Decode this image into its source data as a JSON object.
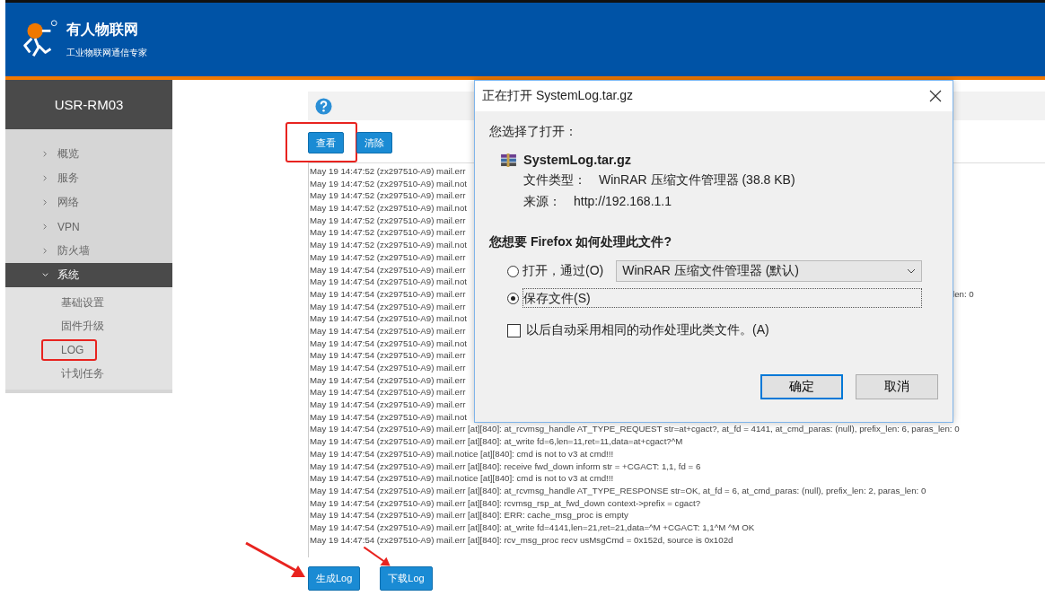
{
  "header": {
    "brand": "有人物联网",
    "slogan": "工业物联网通信专家"
  },
  "sidebar": {
    "device": "USR-RM03",
    "items": [
      {
        "label": "概览",
        "expanded": false,
        "selected": false
      },
      {
        "label": "服务",
        "expanded": false,
        "selected": false
      },
      {
        "label": "网络",
        "expanded": false,
        "selected": false
      },
      {
        "label": "VPN",
        "expanded": false,
        "selected": false
      },
      {
        "label": "防火墙",
        "expanded": false,
        "selected": false
      },
      {
        "label": "系统",
        "expanded": true,
        "selected": true,
        "children": [
          {
            "label": "基础设置",
            "highlighted": false
          },
          {
            "label": "固件升级",
            "highlighted": false
          },
          {
            "label": "LOG",
            "highlighted": true
          },
          {
            "label": "计划任务",
            "highlighted": false
          }
        ]
      }
    ]
  },
  "toolbar": [
    {
      "label": "查看",
      "highlighted": true
    },
    {
      "label": "清除",
      "highlighted": false
    }
  ],
  "log": [
    {
      "text": "May 19 14:47:52 (zx297510-A9) mail.err"
    },
    {
      "text": "May 19 14:47:52 (zx297510-A9) mail.not"
    },
    {
      "text": "May 19 14:47:52 (zx297510-A9) mail.err"
    },
    {
      "text": "May 19 14:47:52 (zx297510-A9) mail.not"
    },
    {
      "text": "May 19 14:47:52 (zx297510-A9) mail.err"
    },
    {
      "text": "May 19 14:47:52 (zx297510-A9) mail.err"
    },
    {
      "text": "May 19 14:47:52 (zx297510-A9) mail.not"
    },
    {
      "text": "May 19 14:47:52 (zx297510-A9) mail.err"
    },
    {
      "text": "May 19 14:47:54 (zx297510-A9) mail.err"
    },
    {
      "text": "May 19 14:47:54 (zx297510-A9) mail.not"
    },
    {
      "text": "May 19 14:47:54 (zx297510-A9) mail.err",
      "tail": "len: 0"
    },
    {
      "text": "May 19 14:47:54 (zx297510-A9) mail.err"
    },
    {
      "text": "May 19 14:47:54 (zx297510-A9) mail.not"
    },
    {
      "text": "May 19 14:47:54 (zx297510-A9) mail.err"
    },
    {
      "text": "May 19 14:47:54 (zx297510-A9) mail.not"
    },
    {
      "text": "May 19 14:47:54 (zx297510-A9) mail.err"
    },
    {
      "text": "May 19 14:47:54 (zx297510-A9) mail.err"
    },
    {
      "text": "May 19 14:47:54 (zx297510-A9) mail.err"
    },
    {
      "text": "May 19 14:47:54 (zx297510-A9) mail.err"
    },
    {
      "text": "May 19 14:47:54 (zx297510-A9) mail.err"
    },
    {
      "text": "May 19 14:47:54 (zx297510-A9) mail.not"
    },
    {
      "text": "May 19 14:47:54 (zx297510-A9) mail.err [at][840]: at_rcvmsg_handle AT_TYPE_REQUEST str=at+cgact?, at_fd = 4141, at_cmd_paras: (null), prefix_len: 6, paras_len: 0"
    },
    {
      "text": "May 19 14:47:54 (zx297510-A9) mail.err [at][840]: at_write fd=6,len=11,ret=11,data=at+cgact?^M"
    },
    {
      "text": "May 19 14:47:54 (zx297510-A9) mail.notice [at][840]: cmd is not to v3 at cmd!!!"
    },
    {
      "text": "May 19 14:47:54 (zx297510-A9) mail.err [at][840]: receive fwd_down inform str = +CGACT: 1,1, fd = 6"
    },
    {
      "text": "May 19 14:47:54 (zx297510-A9) mail.notice [at][840]: cmd is not to v3 at cmd!!!"
    },
    {
      "text": "May 19 14:47:54 (zx297510-A9) mail.err [at][840]: at_rcvmsg_handle AT_TYPE_RESPONSE str=OK, at_fd = 6, at_cmd_paras: (null), prefix_len: 2, paras_len: 0"
    },
    {
      "text": "May 19 14:47:54 (zx297510-A9) mail.err [at][840]: rcvmsg_rsp_at_fwd_down context->prefix = cgact?"
    },
    {
      "text": "May 19 14:47:54 (zx297510-A9) mail.err [at][840]: ERR: cache_msg_proc is empty"
    },
    {
      "text": "May 19 14:47:54 (zx297510-A9) mail.err [at][840]: at_write fd=4141,len=21,ret=21,data=^M +CGACT: 1,1^M ^M OK"
    },
    {
      "text": "May 19 14:47:54 (zx297510-A9) mail.err [at][840]: rcv_msg_proc recv usMsgCmd = 0x152d, source is 0x102d"
    }
  ],
  "bottom_buttons": [
    {
      "label": "生成Log"
    },
    {
      "label": "下载Log"
    }
  ],
  "dialog": {
    "title": "正在打开 SystemLog.tar.gz",
    "intro": "您选择了打开：",
    "file_name": "SystemLog.tar.gz",
    "file_type_label": "文件类型：",
    "file_type": "WinRAR 压缩文件管理器 (38.8 KB)",
    "source_label": "来源：",
    "source": "http://192.168.1.1",
    "question": "您想要 Firefox 如何处理此文件?",
    "options": [
      {
        "kind": "open-with",
        "label": "打开，通过(O)",
        "selected": false,
        "app": "WinRAR 压缩文件管理器 (默认)"
      },
      {
        "kind": "save",
        "label": "保存文件(S)",
        "selected": true
      }
    ],
    "remember": {
      "label": "以后自动采用相同的动作处理此类文件。(A)",
      "checked": false
    },
    "buttons": [
      {
        "label": "确定",
        "default": true
      },
      {
        "label": "取消",
        "default": false
      }
    ]
  }
}
